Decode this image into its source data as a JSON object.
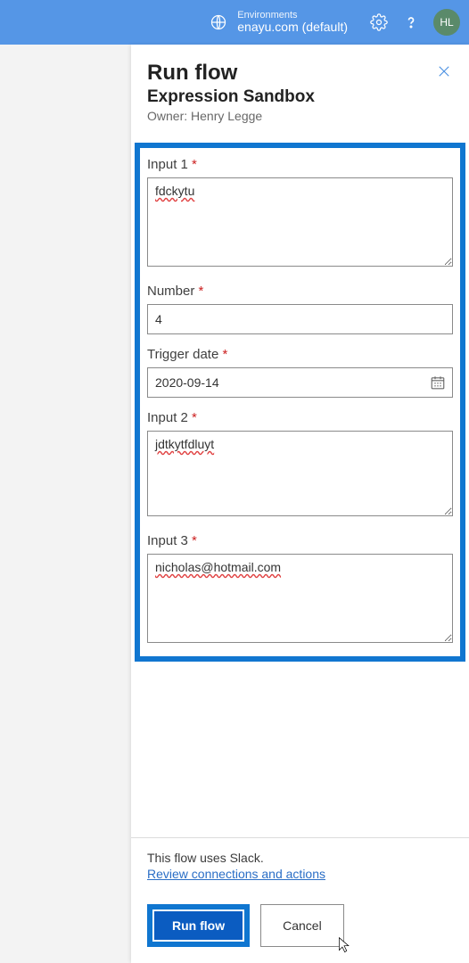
{
  "header": {
    "env_label": "Environments",
    "env_name": "enayu.com (default)",
    "avatar_initials": "HL"
  },
  "panel": {
    "title": "Run flow",
    "flow_name": "Expression Sandbox",
    "owner_text": "Owner: Henry Legge"
  },
  "fields": {
    "input1": {
      "label": "Input 1",
      "value": "fdckytu"
    },
    "number": {
      "label": "Number",
      "value": "4"
    },
    "trigger_date": {
      "label": "Trigger date",
      "value": "2020-09-14"
    },
    "input2": {
      "label": "Input 2",
      "value": "jdtkytfdluyt"
    },
    "input3": {
      "label": "Input 3",
      "value": "nicholas@hotmail.com"
    }
  },
  "footer": {
    "uses_text": "This flow uses Slack.",
    "review_link": "Review connections and actions",
    "run_label": "Run flow",
    "cancel_label": "Cancel"
  },
  "required_mark": " *"
}
